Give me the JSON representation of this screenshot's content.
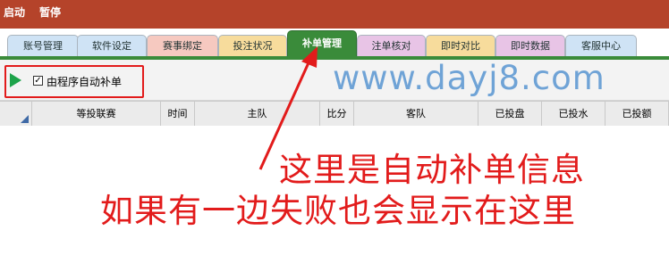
{
  "header": {
    "menu": [
      "启动",
      "暂停"
    ]
  },
  "tabs": [
    {
      "label": "账号管理",
      "color": "#cfe3f5"
    },
    {
      "label": "软件设定",
      "color": "#cfe3f5"
    },
    {
      "label": "赛事绑定",
      "color": "#f6c9c0"
    },
    {
      "label": "投注状况",
      "color": "#f7dc9c"
    },
    {
      "label": "补单管理",
      "color": "#3a8b3a",
      "active": true
    },
    {
      "label": "注单核对",
      "color": "#e8c4e6"
    },
    {
      "label": "即时对比",
      "color": "#f7dc9c"
    },
    {
      "label": "即时数据",
      "color": "#e8c4e6"
    },
    {
      "label": "客服中心",
      "color": "#cfe3f5"
    }
  ],
  "toolbar": {
    "checkbox_label": "由程序自动补单",
    "checked": true
  },
  "watermark": "www.dayj8.com",
  "grid": {
    "columns": [
      "等投联赛",
      "时间",
      "主队",
      "比分",
      "客队",
      "已投盘",
      "已投水",
      "已投额"
    ]
  },
  "annotation": {
    "line1": "这里是自动补单信息",
    "line2": "如果有一边失败也会显示在这里"
  }
}
